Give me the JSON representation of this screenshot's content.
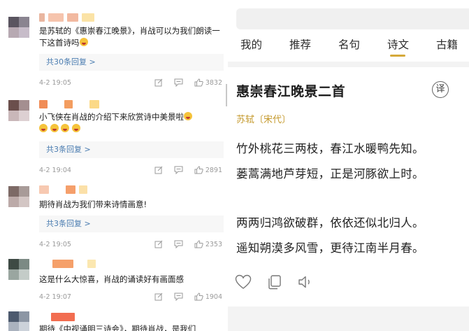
{
  "comments": [
    {
      "text": "是苏轼的《惠崇春江晚景》，肖战可以为我们朗读一下这首诗吗",
      "reply_label": "共30条回复 >",
      "date": "4-2 19:05",
      "likes": "3832"
    },
    {
      "text": "小飞侠在肖战的介绍下来欣赏诗中美景啦",
      "reply_label": "共3条回复 >",
      "date": "4-2 19:04",
      "likes": "2891"
    },
    {
      "text": "期待肖战为我们带来诗情画意!",
      "reply_label": "共3条回复 >",
      "date": "4-2 19:05",
      "likes": "2353"
    },
    {
      "text": "这是什么大惊喜，肖战的诵读好有画面感",
      "date": "4-2 19:07",
      "likes": "1904"
    },
    {
      "text": "期待《中视诵明三诗会》，期待肖战，是我们"
    }
  ],
  "tabs": [
    "我的",
    "推荐",
    "名句",
    "诗文",
    "古籍"
  ],
  "active_tab": "诗文",
  "poem": {
    "title": "惠崇春江晚景二首",
    "translate_label": "译",
    "author": "苏轼〔宋代〕",
    "lines": [
      "竹外桃花三两枝，春江水暖鸭先知。",
      "蒌蒿满地芦芽短，正是河豚欲上时。",
      "两两归鸿欲破群，依依还似北归人。",
      "遥知朔漠多风雪，更待江南半月春。"
    ]
  },
  "icons": [
    "heart-icon",
    "copy-icon",
    "sound-icon",
    "edit-icon",
    "comment-icon",
    "thumbs-up-icon"
  ],
  "colors": {
    "accent": "#d5a93a",
    "author": "#c59a2e",
    "reply_link": "#4a7cb0"
  }
}
